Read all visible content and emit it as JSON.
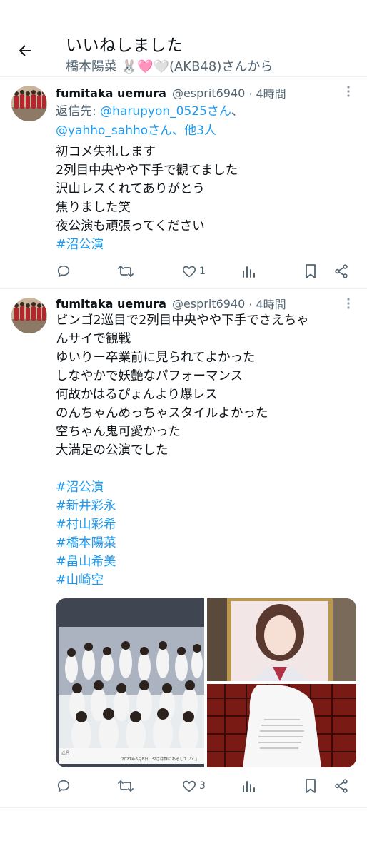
{
  "header": {
    "title": "いいねしました",
    "subtitle": "橋本陽菜 🐰🩷🤍(AKB48)さんから"
  },
  "tweets": [
    {
      "name": "fumitaka uemura",
      "handle": "@esprit6940",
      "time": "· 4時間",
      "reply_prefix": "返信先: ",
      "reply_user1": "@harupyon_0525さん",
      "reply_sep": "、",
      "reply_user2": "@yahho_sahhoさん",
      "reply_others": "、他3人",
      "lines": [
        "初コメ失礼します",
        "2列目中央やや下手で観てました",
        "沢山レスくれてありがとう",
        "焦りました笑",
        "夜公演も頑張ってください"
      ],
      "hashtags": [
        "#沼公演"
      ],
      "likes": "1"
    },
    {
      "name": "fumitaka uemura",
      "handle": "@esprit6940",
      "time": "· 4時間",
      "lines": [
        "ビンゴ2巡目で2列目中央やや下手でさえちゃ",
        "んサイで観戦",
        "ゆいりー卒業前に見られてよかった",
        "しなやかで妖艶なパフォーマンス",
        "何故かはるぴょんより爆レス",
        "のんちゃんめっちゃスタイルよかった",
        "空ちゃん鬼可愛かった",
        "大満足の公演でした"
      ],
      "hashtags": [
        "#沼公演",
        "#新井彩永",
        "#村山彩希",
        "#橋本陽菜",
        "#畠山希美",
        "#山崎空"
      ],
      "likes": "3",
      "photo_caption": "2021年6月8日「やさは誰にあるしていく」",
      "photo_badge": "48"
    }
  ],
  "colors": {
    "text": "#0f1419",
    "secondary": "#536471",
    "link": "#1d9bf0",
    "divider": "#eff3f4"
  },
  "icons": [
    "back-arrow-icon",
    "more-icon",
    "reply-icon",
    "retweet-icon",
    "heart-icon",
    "analytics-icon",
    "bookmark-icon",
    "share-icon"
  ]
}
